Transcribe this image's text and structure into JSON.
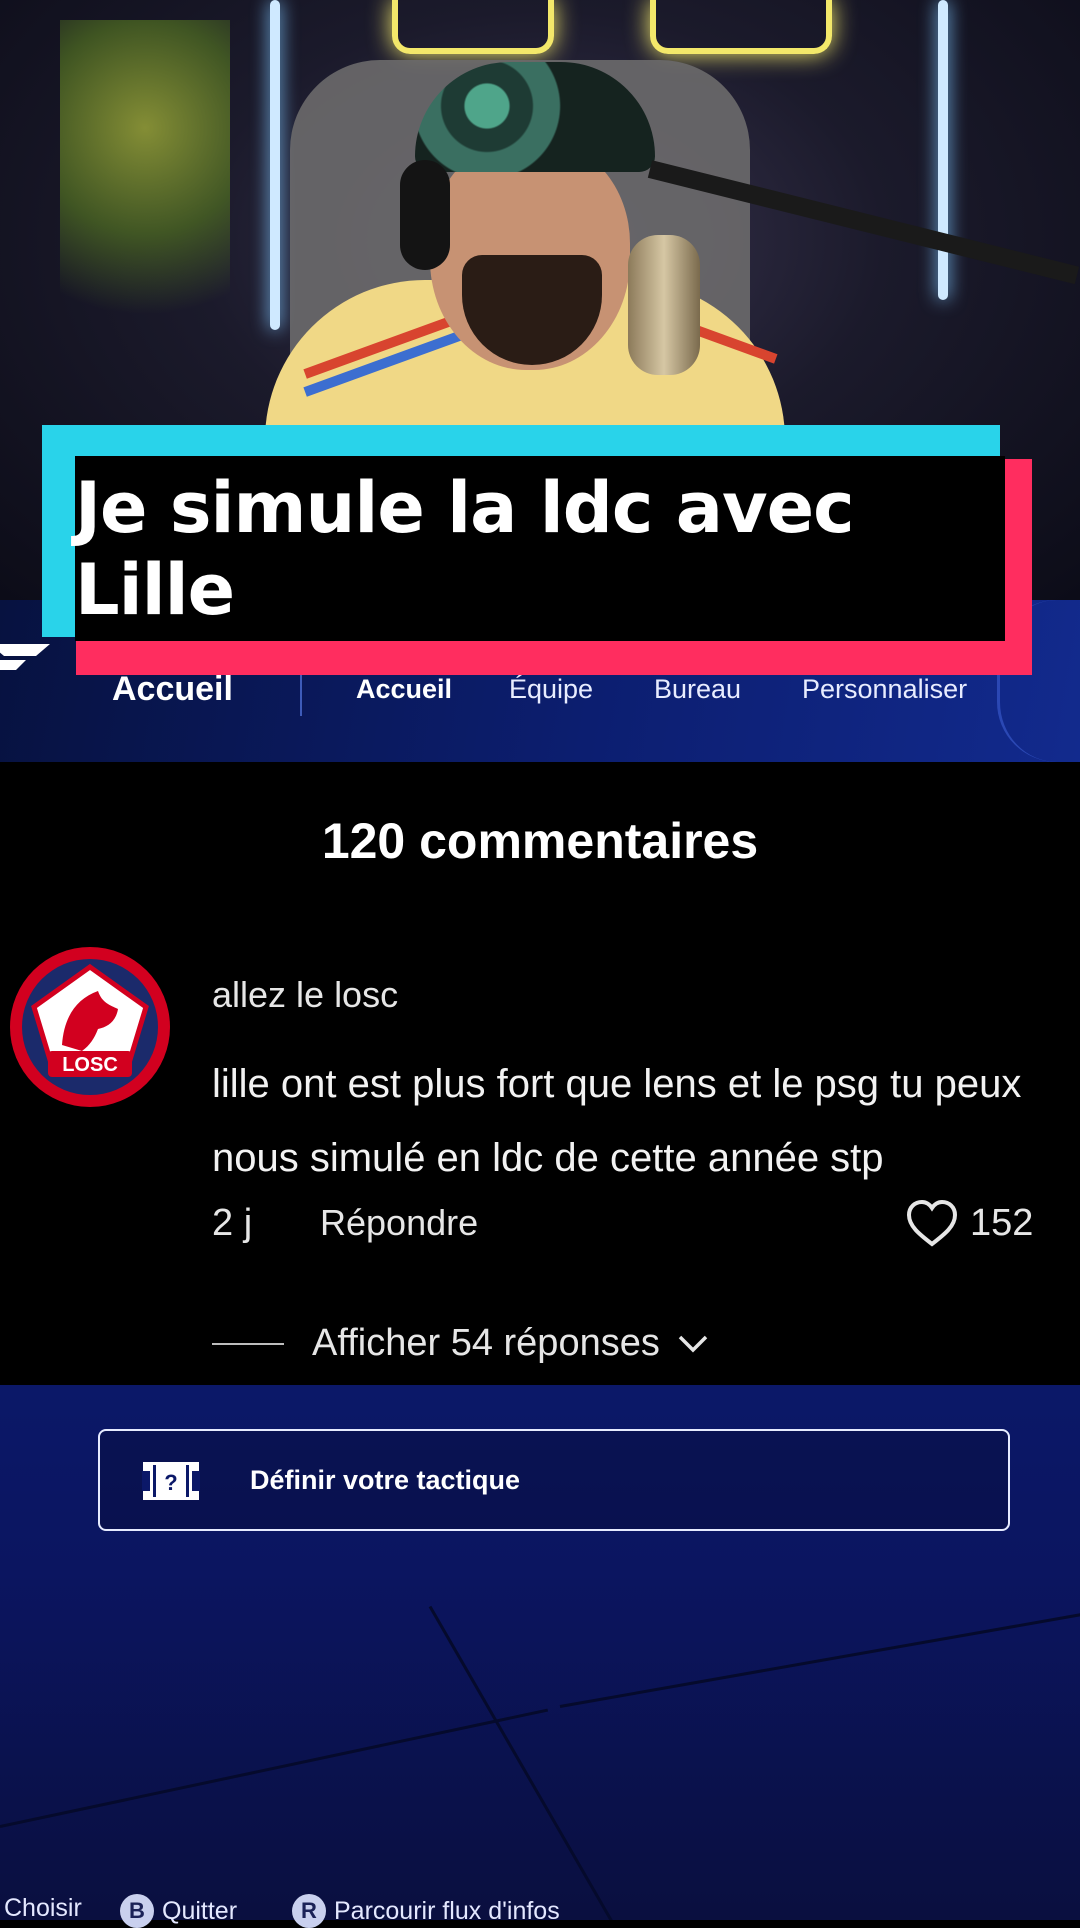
{
  "video": {
    "title": "Je simule la ldc avec Lille"
  },
  "game_menu": {
    "section_title": "Accueil",
    "tabs": [
      {
        "label": "Accueil",
        "active": true
      },
      {
        "label": "Équipe",
        "active": false
      },
      {
        "label": "Bureau",
        "active": false
      },
      {
        "label": "Personnaliser",
        "active": false
      }
    ]
  },
  "comments": {
    "heading": "120 commentaires",
    "items": [
      {
        "username": "allez le losc",
        "avatar_text": "LOSC",
        "text": "lille ont est plus fort que lens et le psg tu peux nous simulé en ldc de cette année stp",
        "age": "2 j",
        "reply_label": "Répondre",
        "likes": "152",
        "show_replies": "Afficher 54 réponses"
      }
    ]
  },
  "tactic_button": {
    "label": "Définir votre tactique",
    "icon_text": "?"
  },
  "controls_legend": [
    {
      "key": "",
      "label": "Choisir"
    },
    {
      "key": "B",
      "label": "Quitter"
    },
    {
      "key": "R",
      "label": "Parcourir flux d'infos"
    }
  ],
  "colors": {
    "banner_cyan": "#29d3ea",
    "banner_pink": "#ff2d5f",
    "menu_blue": "#0c1e70",
    "losc_red": "#d2001f"
  }
}
